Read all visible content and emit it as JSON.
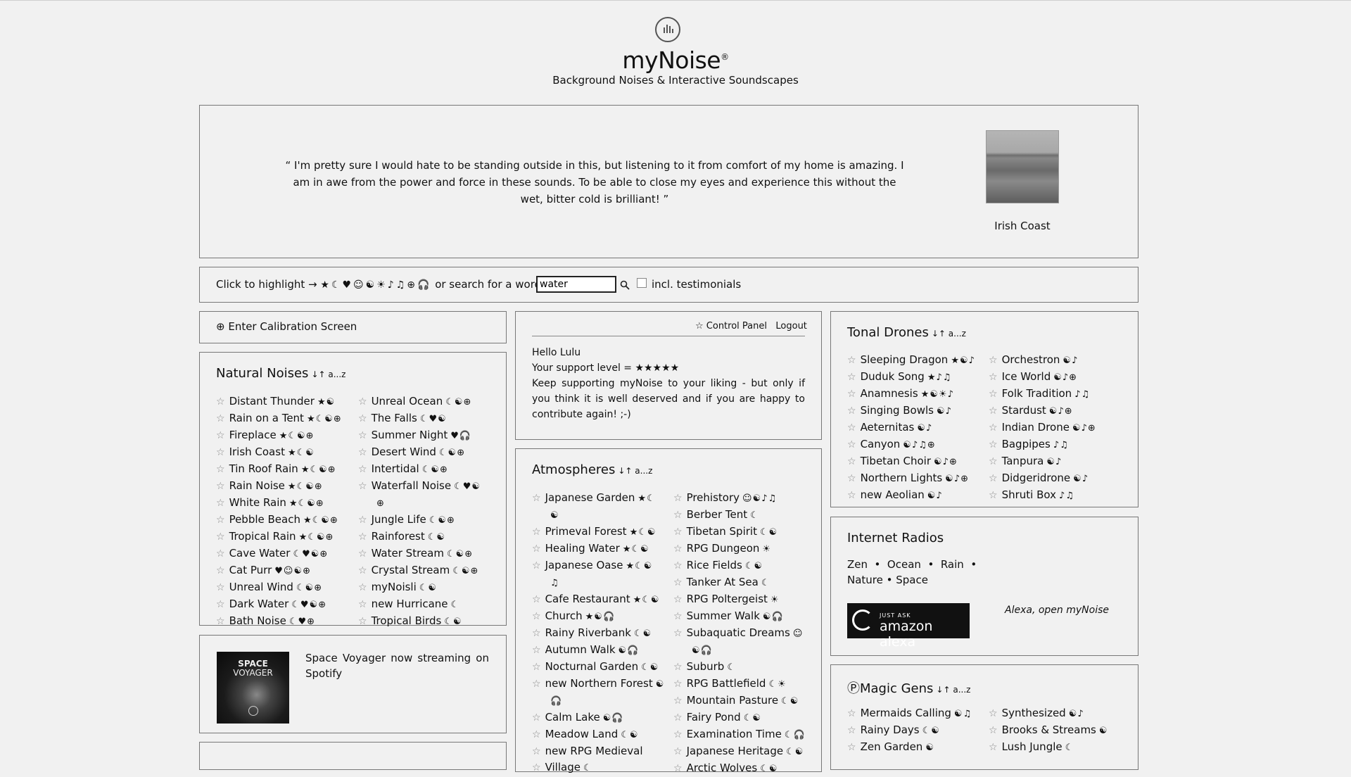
{
  "header": {
    "title": "myNoise",
    "trademark": "®",
    "subtitle": "Background Noises & Interactive Soundscapes"
  },
  "testimonial": {
    "quote": "“ I'm pretty sure I would hate to be standing outside in this, but listening to it from comfort of my home is amazing. I am in awe from the power and force in these sounds. To be able to close my eyes and experience this without the wet, bitter cold is brilliant! ”",
    "generator_name": "Irish Coast"
  },
  "highlight_bar": {
    "label": "Click to highlight →",
    "symbols": "★☾♥☺☯☀♪♫⊕🎧",
    "search_label": "or search for a word",
    "search_value": "water",
    "testimonials_label": "incl. testimonials"
  },
  "calibration": {
    "label": "⊕ Enter Calibration Screen"
  },
  "natural_noises": {
    "title": "Natural Noises",
    "sort": "↓↑ a...z",
    "col1": [
      {
        "name": "Distant Thunder",
        "tags": "★☯"
      },
      {
        "name": "Rain on a Tent",
        "tags": "★☾☯⊕"
      },
      {
        "name": "Fireplace",
        "tags": "★☾☯⊕"
      },
      {
        "name": "Irish Coast",
        "tags": "★☾☯"
      },
      {
        "name": "Tin Roof Rain",
        "tags": "★☾☯⊕"
      },
      {
        "name": "Rain Noise",
        "tags": "★☾☯⊕"
      },
      {
        "name": "White Rain",
        "tags": "★☾☯⊕"
      },
      {
        "name": "Pebble Beach",
        "tags": "★☾☯⊕"
      },
      {
        "name": "Tropical Rain",
        "tags": "★☾☯⊕"
      },
      {
        "name": "Cave Water",
        "tags": "☾♥☯⊕"
      },
      {
        "name": "Cat Purr",
        "tags": "♥☺☯⊕"
      },
      {
        "name": "Unreal Wind",
        "tags": "☾☯⊕"
      },
      {
        "name": "Dark Water",
        "tags": "☾♥☯⊕"
      },
      {
        "name": "Bath Noise",
        "tags": "☾♥⊕"
      }
    ],
    "col2": [
      {
        "name": "Unreal Ocean",
        "tags": "☾☯⊕"
      },
      {
        "name": "The Falls",
        "tags": "☾♥☯"
      },
      {
        "name": "Summer Night",
        "tags": "♥🎧"
      },
      {
        "name": "Desert Wind",
        "tags": "☾☯⊕"
      },
      {
        "name": "Intertidal",
        "tags": "☾☯⊕"
      },
      {
        "name": "Waterfall Noise",
        "tags": "☾♥☯"
      },
      {
        "name": "",
        "tags": "⊕"
      },
      {
        "name": "Jungle Life",
        "tags": "☾☯⊕"
      },
      {
        "name": "Rainforest",
        "tags": "☾☯"
      },
      {
        "name": "Water Stream",
        "tags": "☾☯⊕"
      },
      {
        "name": "Crystal Stream",
        "tags": "☾☯⊕"
      },
      {
        "name": "myNoisli",
        "tags": "☾☯"
      },
      {
        "name": "new Hurricane",
        "tags": "☾"
      },
      {
        "name": "Tropical Birds",
        "tags": "☾☯"
      }
    ]
  },
  "space_voyager": {
    "img_line1": "SPACE",
    "img_line2": "VOYAGER",
    "text": "Space Voyager now streaming on Spotify"
  },
  "control_panel": {
    "control_label": "☆ Control Panel",
    "logout_label": "Logout",
    "greeting": "Hello Lulu",
    "support": "Your support level = ★★★★★",
    "message": "Keep supporting myNoise to your liking - but only if you think it is well deserved and if you are happy to contribute again! ;-)"
  },
  "atmospheres": {
    "title": "Atmospheres",
    "sort": "↓↑ a...z",
    "col1": [
      {
        "name": "Japanese Garden",
        "tags": "★☾"
      },
      {
        "name": "",
        "tags": "☯"
      },
      {
        "name": "Primeval Forest",
        "tags": "★☾☯"
      },
      {
        "name": "Healing Water",
        "tags": "★☾☯"
      },
      {
        "name": "Japanese Oase",
        "tags": "★☾☯"
      },
      {
        "name": "",
        "tags": "♫"
      },
      {
        "name": "Cafe Restaurant",
        "tags": "★☾☯"
      },
      {
        "name": "Church",
        "tags": "★☯🎧"
      },
      {
        "name": "Rainy Riverbank",
        "tags": "☾☯"
      },
      {
        "name": "Autumn Walk",
        "tags": "☯🎧"
      },
      {
        "name": "Nocturnal Garden",
        "tags": "☾☯"
      },
      {
        "name": "new Northern Forest",
        "tags": "☯"
      },
      {
        "name": "",
        "tags": "🎧"
      },
      {
        "name": "Calm Lake",
        "tags": "☯🎧"
      },
      {
        "name": "Meadow Land",
        "tags": "☾☯"
      },
      {
        "name": "new RPG Medieval",
        "tags": ""
      },
      {
        "name": "Village",
        "tags": "☾"
      }
    ],
    "col2": [
      {
        "name": "Prehistory",
        "tags": "☺☯♪♫"
      },
      {
        "name": "Berber Tent",
        "tags": "☾"
      },
      {
        "name": "Tibetan Spirit",
        "tags": "☾☯"
      },
      {
        "name": "RPG Dungeon",
        "tags": "☀"
      },
      {
        "name": "Rice Fields",
        "tags": "☾☯"
      },
      {
        "name": "Tanker At Sea",
        "tags": "☾"
      },
      {
        "name": "RPG Poltergeist",
        "tags": "☀"
      },
      {
        "name": "Summer Walk",
        "tags": "☯🎧"
      },
      {
        "name": "Subaquatic Dreams",
        "tags": "☺"
      },
      {
        "name": "",
        "tags": "☯🎧"
      },
      {
        "name": "Suburb",
        "tags": "☾"
      },
      {
        "name": "RPG Battlefield",
        "tags": "☾☀"
      },
      {
        "name": "Mountain Pasture",
        "tags": "☾☯"
      },
      {
        "name": "Fairy Pond",
        "tags": "☾☯"
      },
      {
        "name": "Examination Time",
        "tags": "☾🎧"
      },
      {
        "name": "Japanese Heritage",
        "tags": "☾☯"
      },
      {
        "name": "Arctic Wolves",
        "tags": "☾☯"
      }
    ]
  },
  "tonal_drones": {
    "title": "Tonal Drones",
    "sort": "↓↑ a...z",
    "col1": [
      {
        "name": "Sleeping Dragon",
        "tags": "★☯♪"
      },
      {
        "name": "Duduk Song",
        "tags": "★♪♫"
      },
      {
        "name": "Anamnesis",
        "tags": "★☯☀♪"
      },
      {
        "name": "Singing Bowls",
        "tags": "☯♪"
      },
      {
        "name": "Aeternitas",
        "tags": "☯♪"
      },
      {
        "name": "Canyon",
        "tags": "☯♪♫⊕"
      },
      {
        "name": "Tibetan Choir",
        "tags": "☯♪⊕"
      },
      {
        "name": "Northern Lights",
        "tags": "☯♪⊕"
      },
      {
        "name": "new Aeolian",
        "tags": "☯♪"
      }
    ],
    "col2": [
      {
        "name": "Orchestron",
        "tags": "☯♪"
      },
      {
        "name": "Ice World",
        "tags": "☯♪⊕"
      },
      {
        "name": "Folk Tradition",
        "tags": "♪♫"
      },
      {
        "name": "Stardust",
        "tags": "☯♪⊕"
      },
      {
        "name": "Indian Drone",
        "tags": "☯♪⊕"
      },
      {
        "name": "Bagpipes",
        "tags": "♪♫"
      },
      {
        "name": "Tanpura",
        "tags": "☯♪"
      },
      {
        "name": "Didgeridrone",
        "tags": "☯♪"
      },
      {
        "name": "Shruti Box",
        "tags": "♪♫"
      }
    ]
  },
  "internet_radios": {
    "title": "Internet Radios",
    "line1": "Zen  •  Ocean  •  Rain  •",
    "line2": "Nature • Space",
    "alexa_small": "JUST ASK",
    "alexa_big": "amazon alexa",
    "alexa_phrase": "Alexa, open myNoise"
  },
  "magic_gens": {
    "title": "Magic Gens",
    "sort": "↓↑ a...z",
    "col1": [
      {
        "name": "Mermaids Calling",
        "tags": "☯♫"
      },
      {
        "name": "Rainy Days",
        "tags": "☾☯"
      },
      {
        "name": "Zen Garden",
        "tags": "☯"
      }
    ],
    "col2": [
      {
        "name": "Synthesized",
        "tags": "☯♪"
      },
      {
        "name": "Brooks & Streams",
        "tags": "☯"
      },
      {
        "name": "Lush Jungle",
        "tags": "☾"
      }
    ]
  }
}
